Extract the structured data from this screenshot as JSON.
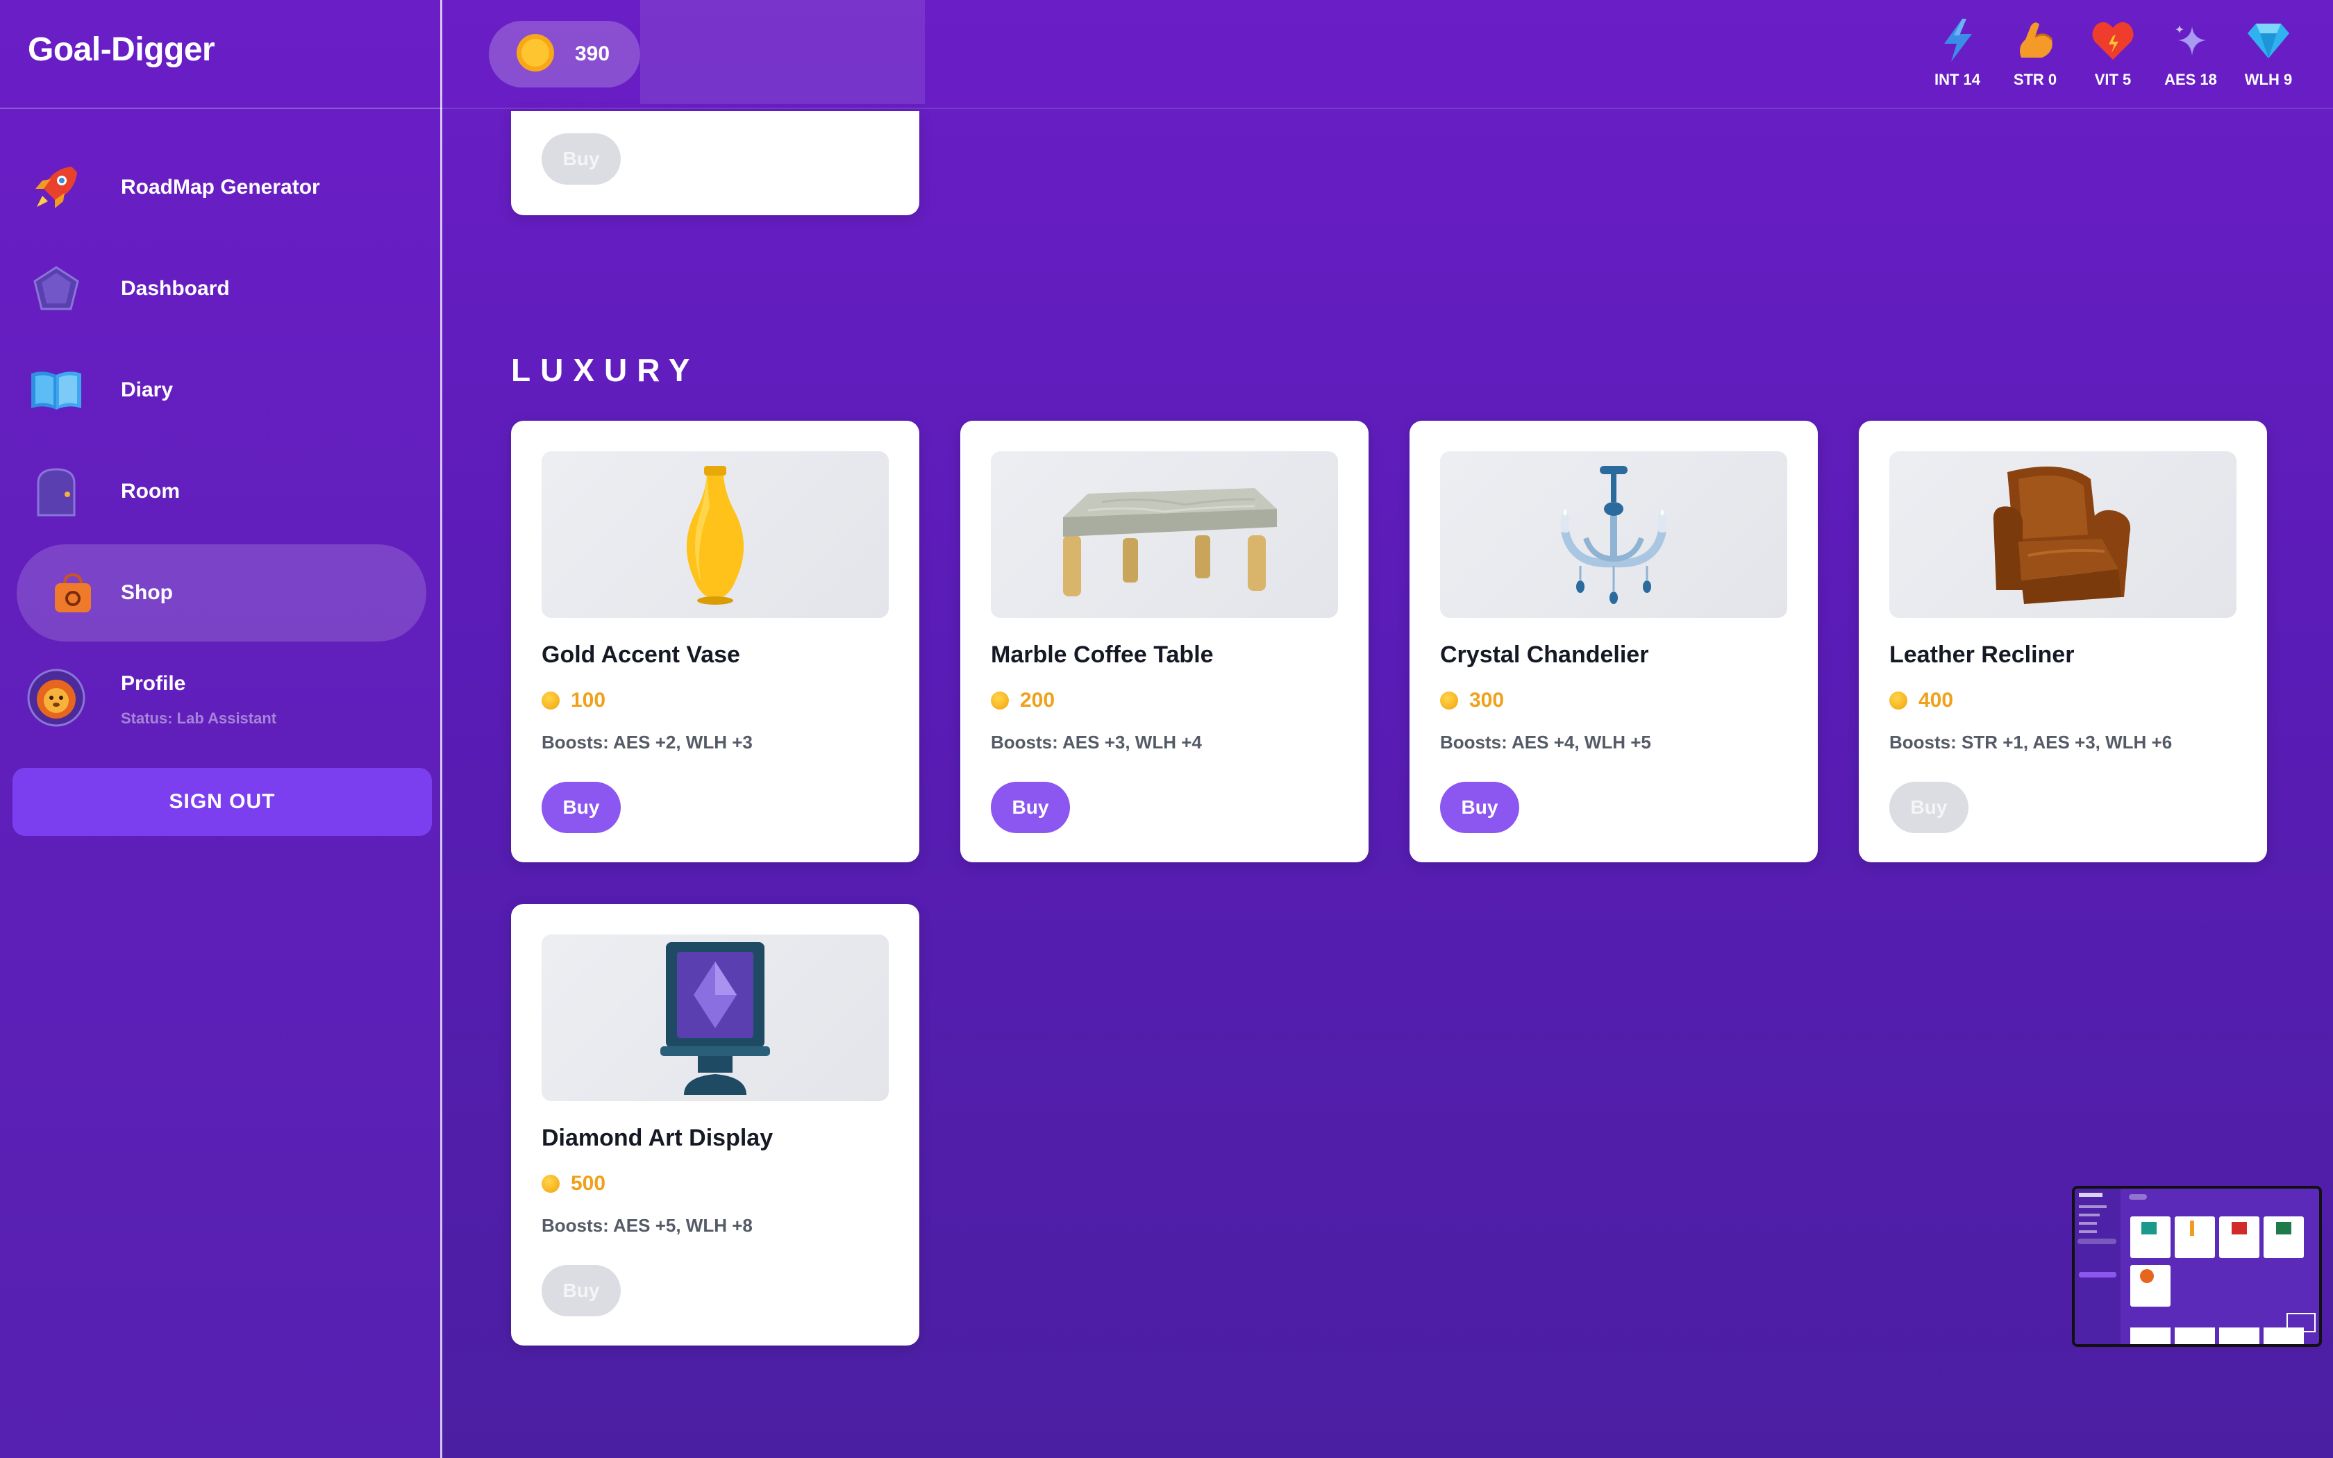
{
  "app": {
    "brand": "Goal-Digger"
  },
  "sidebar": {
    "items": [
      {
        "label": "RoadMap Generator",
        "icon": "rocket-icon"
      },
      {
        "label": "Dashboard",
        "icon": "pentagon-gem-icon"
      },
      {
        "label": "Diary",
        "icon": "open-book-icon"
      },
      {
        "label": "Room",
        "icon": "door-icon"
      },
      {
        "label": "Shop",
        "icon": "shopping-bag-icon",
        "active": true
      },
      {
        "label": "Profile",
        "icon": "lion-avatar-icon",
        "sub": "Status: Lab Assistant"
      }
    ],
    "signout": "SIGN OUT"
  },
  "header": {
    "coins": "390",
    "stats": [
      {
        "label": "INT 14",
        "icon": "lightning-icon"
      },
      {
        "label": "STR 0",
        "icon": "flexed-arm-icon"
      },
      {
        "label": "VIT 5",
        "icon": "heart-icon"
      },
      {
        "label": "AES 18",
        "icon": "sparkle-icon"
      },
      {
        "label": "WLH 9",
        "icon": "diamond-icon"
      }
    ]
  },
  "shop": {
    "partial_card": {
      "buy_label": "Buy"
    },
    "luxury": {
      "title": "LUXURY",
      "items": [
        {
          "name": "Gold Accent Vase",
          "price": "100",
          "boosts": "Boosts: AES +2, WLH +3",
          "buy_label": "Buy",
          "affordable": true,
          "image": "gold-vase"
        },
        {
          "name": "Marble Coffee Table",
          "price": "200",
          "boosts": "Boosts: AES +3, WLH +4",
          "buy_label": "Buy",
          "affordable": true,
          "image": "marble-table"
        },
        {
          "name": "Crystal Chandelier",
          "price": "300",
          "boosts": "Boosts: AES +4, WLH +5",
          "buy_label": "Buy",
          "affordable": true,
          "image": "chandelier"
        },
        {
          "name": "Leather Recliner",
          "price": "400",
          "boosts": "Boosts: STR +1, AES +3, WLH +6",
          "buy_label": "Buy",
          "affordable": false,
          "image": "recliner"
        },
        {
          "name": "Diamond Art Display",
          "price": "500",
          "boosts": "Boosts: AES +5, WLH +8",
          "buy_label": "Buy",
          "affordable": false,
          "image": "diamond-display"
        }
      ]
    }
  },
  "colors": {
    "accent": "#8b57f0",
    "coin": "#f0a11b",
    "background": "#5a1cb6"
  }
}
